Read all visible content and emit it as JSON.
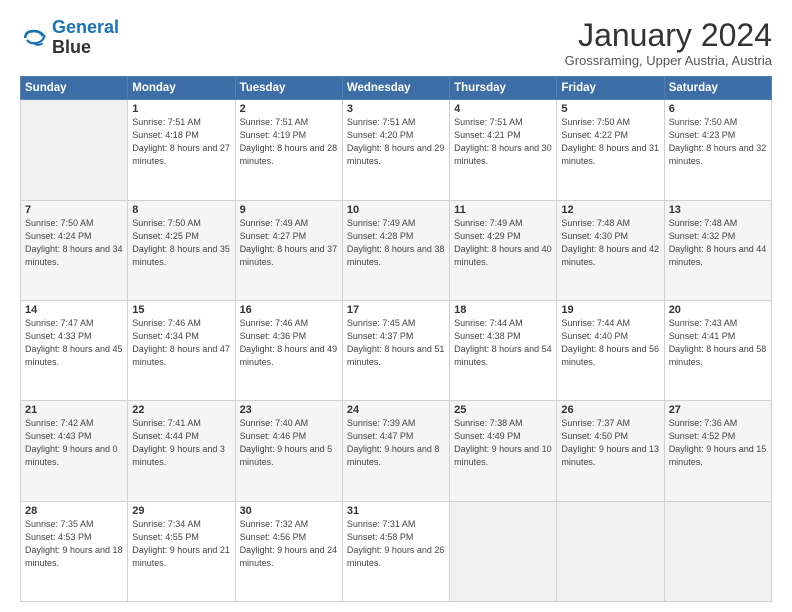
{
  "logo": {
    "line1": "General",
    "line2": "Blue"
  },
  "title": "January 2024",
  "subtitle": "Grossraming, Upper Austria, Austria",
  "days_of_week": [
    "Sunday",
    "Monday",
    "Tuesday",
    "Wednesday",
    "Thursday",
    "Friday",
    "Saturday"
  ],
  "weeks": [
    [
      {
        "day": "",
        "sunrise": "",
        "sunset": "",
        "daylight": ""
      },
      {
        "day": "1",
        "sunrise": "Sunrise: 7:51 AM",
        "sunset": "Sunset: 4:18 PM",
        "daylight": "Daylight: 8 hours and 27 minutes."
      },
      {
        "day": "2",
        "sunrise": "Sunrise: 7:51 AM",
        "sunset": "Sunset: 4:19 PM",
        "daylight": "Daylight: 8 hours and 28 minutes."
      },
      {
        "day": "3",
        "sunrise": "Sunrise: 7:51 AM",
        "sunset": "Sunset: 4:20 PM",
        "daylight": "Daylight: 8 hours and 29 minutes."
      },
      {
        "day": "4",
        "sunrise": "Sunrise: 7:51 AM",
        "sunset": "Sunset: 4:21 PM",
        "daylight": "Daylight: 8 hours and 30 minutes."
      },
      {
        "day": "5",
        "sunrise": "Sunrise: 7:50 AM",
        "sunset": "Sunset: 4:22 PM",
        "daylight": "Daylight: 8 hours and 31 minutes."
      },
      {
        "day": "6",
        "sunrise": "Sunrise: 7:50 AM",
        "sunset": "Sunset: 4:23 PM",
        "daylight": "Daylight: 8 hours and 32 minutes."
      }
    ],
    [
      {
        "day": "7",
        "sunrise": "Sunrise: 7:50 AM",
        "sunset": "Sunset: 4:24 PM",
        "daylight": "Daylight: 8 hours and 34 minutes."
      },
      {
        "day": "8",
        "sunrise": "Sunrise: 7:50 AM",
        "sunset": "Sunset: 4:25 PM",
        "daylight": "Daylight: 8 hours and 35 minutes."
      },
      {
        "day": "9",
        "sunrise": "Sunrise: 7:49 AM",
        "sunset": "Sunset: 4:27 PM",
        "daylight": "Daylight: 8 hours and 37 minutes."
      },
      {
        "day": "10",
        "sunrise": "Sunrise: 7:49 AM",
        "sunset": "Sunset: 4:28 PM",
        "daylight": "Daylight: 8 hours and 38 minutes."
      },
      {
        "day": "11",
        "sunrise": "Sunrise: 7:49 AM",
        "sunset": "Sunset: 4:29 PM",
        "daylight": "Daylight: 8 hours and 40 minutes."
      },
      {
        "day": "12",
        "sunrise": "Sunrise: 7:48 AM",
        "sunset": "Sunset: 4:30 PM",
        "daylight": "Daylight: 8 hours and 42 minutes."
      },
      {
        "day": "13",
        "sunrise": "Sunrise: 7:48 AM",
        "sunset": "Sunset: 4:32 PM",
        "daylight": "Daylight: 8 hours and 44 minutes."
      }
    ],
    [
      {
        "day": "14",
        "sunrise": "Sunrise: 7:47 AM",
        "sunset": "Sunset: 4:33 PM",
        "daylight": "Daylight: 8 hours and 45 minutes."
      },
      {
        "day": "15",
        "sunrise": "Sunrise: 7:46 AM",
        "sunset": "Sunset: 4:34 PM",
        "daylight": "Daylight: 8 hours and 47 minutes."
      },
      {
        "day": "16",
        "sunrise": "Sunrise: 7:46 AM",
        "sunset": "Sunset: 4:36 PM",
        "daylight": "Daylight: 8 hours and 49 minutes."
      },
      {
        "day": "17",
        "sunrise": "Sunrise: 7:45 AM",
        "sunset": "Sunset: 4:37 PM",
        "daylight": "Daylight: 8 hours and 51 minutes."
      },
      {
        "day": "18",
        "sunrise": "Sunrise: 7:44 AM",
        "sunset": "Sunset: 4:38 PM",
        "daylight": "Daylight: 8 hours and 54 minutes."
      },
      {
        "day": "19",
        "sunrise": "Sunrise: 7:44 AM",
        "sunset": "Sunset: 4:40 PM",
        "daylight": "Daylight: 8 hours and 56 minutes."
      },
      {
        "day": "20",
        "sunrise": "Sunrise: 7:43 AM",
        "sunset": "Sunset: 4:41 PM",
        "daylight": "Daylight: 8 hours and 58 minutes."
      }
    ],
    [
      {
        "day": "21",
        "sunrise": "Sunrise: 7:42 AM",
        "sunset": "Sunset: 4:43 PM",
        "daylight": "Daylight: 9 hours and 0 minutes."
      },
      {
        "day": "22",
        "sunrise": "Sunrise: 7:41 AM",
        "sunset": "Sunset: 4:44 PM",
        "daylight": "Daylight: 9 hours and 3 minutes."
      },
      {
        "day": "23",
        "sunrise": "Sunrise: 7:40 AM",
        "sunset": "Sunset: 4:46 PM",
        "daylight": "Daylight: 9 hours and 5 minutes."
      },
      {
        "day": "24",
        "sunrise": "Sunrise: 7:39 AM",
        "sunset": "Sunset: 4:47 PM",
        "daylight": "Daylight: 9 hours and 8 minutes."
      },
      {
        "day": "25",
        "sunrise": "Sunrise: 7:38 AM",
        "sunset": "Sunset: 4:49 PM",
        "daylight": "Daylight: 9 hours and 10 minutes."
      },
      {
        "day": "26",
        "sunrise": "Sunrise: 7:37 AM",
        "sunset": "Sunset: 4:50 PM",
        "daylight": "Daylight: 9 hours and 13 minutes."
      },
      {
        "day": "27",
        "sunrise": "Sunrise: 7:36 AM",
        "sunset": "Sunset: 4:52 PM",
        "daylight": "Daylight: 9 hours and 15 minutes."
      }
    ],
    [
      {
        "day": "28",
        "sunrise": "Sunrise: 7:35 AM",
        "sunset": "Sunset: 4:53 PM",
        "daylight": "Daylight: 9 hours and 18 minutes."
      },
      {
        "day": "29",
        "sunrise": "Sunrise: 7:34 AM",
        "sunset": "Sunset: 4:55 PM",
        "daylight": "Daylight: 9 hours and 21 minutes."
      },
      {
        "day": "30",
        "sunrise": "Sunrise: 7:32 AM",
        "sunset": "Sunset: 4:56 PM",
        "daylight": "Daylight: 9 hours and 24 minutes."
      },
      {
        "day": "31",
        "sunrise": "Sunrise: 7:31 AM",
        "sunset": "Sunset: 4:58 PM",
        "daylight": "Daylight: 9 hours and 26 minutes."
      },
      {
        "day": "",
        "sunrise": "",
        "sunset": "",
        "daylight": ""
      },
      {
        "day": "",
        "sunrise": "",
        "sunset": "",
        "daylight": ""
      },
      {
        "day": "",
        "sunrise": "",
        "sunset": "",
        "daylight": ""
      }
    ]
  ]
}
